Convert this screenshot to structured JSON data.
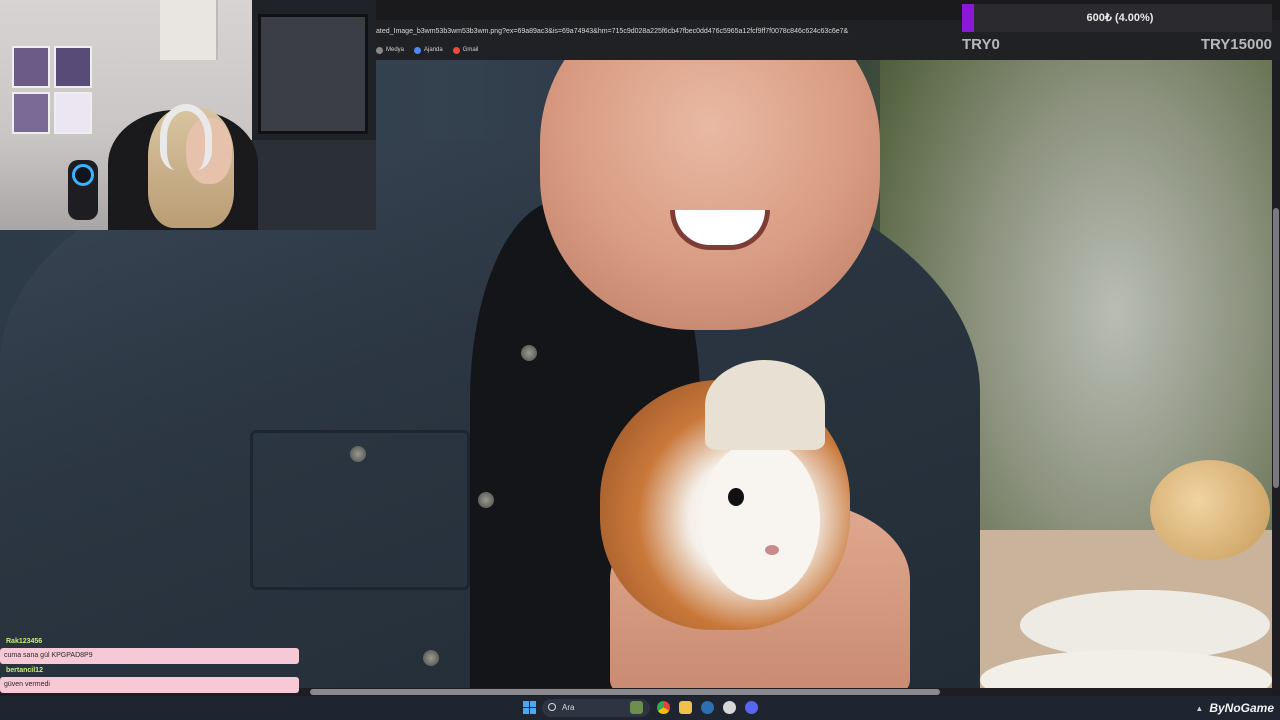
{
  "browser": {
    "address_text": "ated_Image_b3wm53b3wm53b3wm.png?ex=69a89ac3&is=69a74943&hm=715c9d028a225f6cb47fbec0dd476c5965a12fcf9ff7f0078c846c624c63c6e7&",
    "bookmarks": [
      {
        "label": "Medya",
        "icon": "media-icon"
      },
      {
        "label": "Ajanda",
        "icon": "calendar-icon"
      },
      {
        "label": "Gmail",
        "icon": "gmail-icon"
      }
    ]
  },
  "donation_goal": {
    "current_text": "600₺ (4.00%)",
    "progress_fraction": 0.04,
    "min_label": "TRY0",
    "max_label": "TRY15000",
    "accent_color": "#8b18d8"
  },
  "chat": {
    "messages": [
      {
        "user": "Rak123456",
        "text": "cuma sana gül KPGPAD8P9"
      },
      {
        "user": "bertancil12",
        "text": "güven vermedi"
      }
    ]
  },
  "taskbar": {
    "search_placeholder": "Ara",
    "watermark": "ByNoGame",
    "pinned_icons": [
      "widgets-icon",
      "chrome-icon",
      "file-explorer-icon",
      "steam-icon",
      "app-icon",
      "discord-icon"
    ]
  }
}
